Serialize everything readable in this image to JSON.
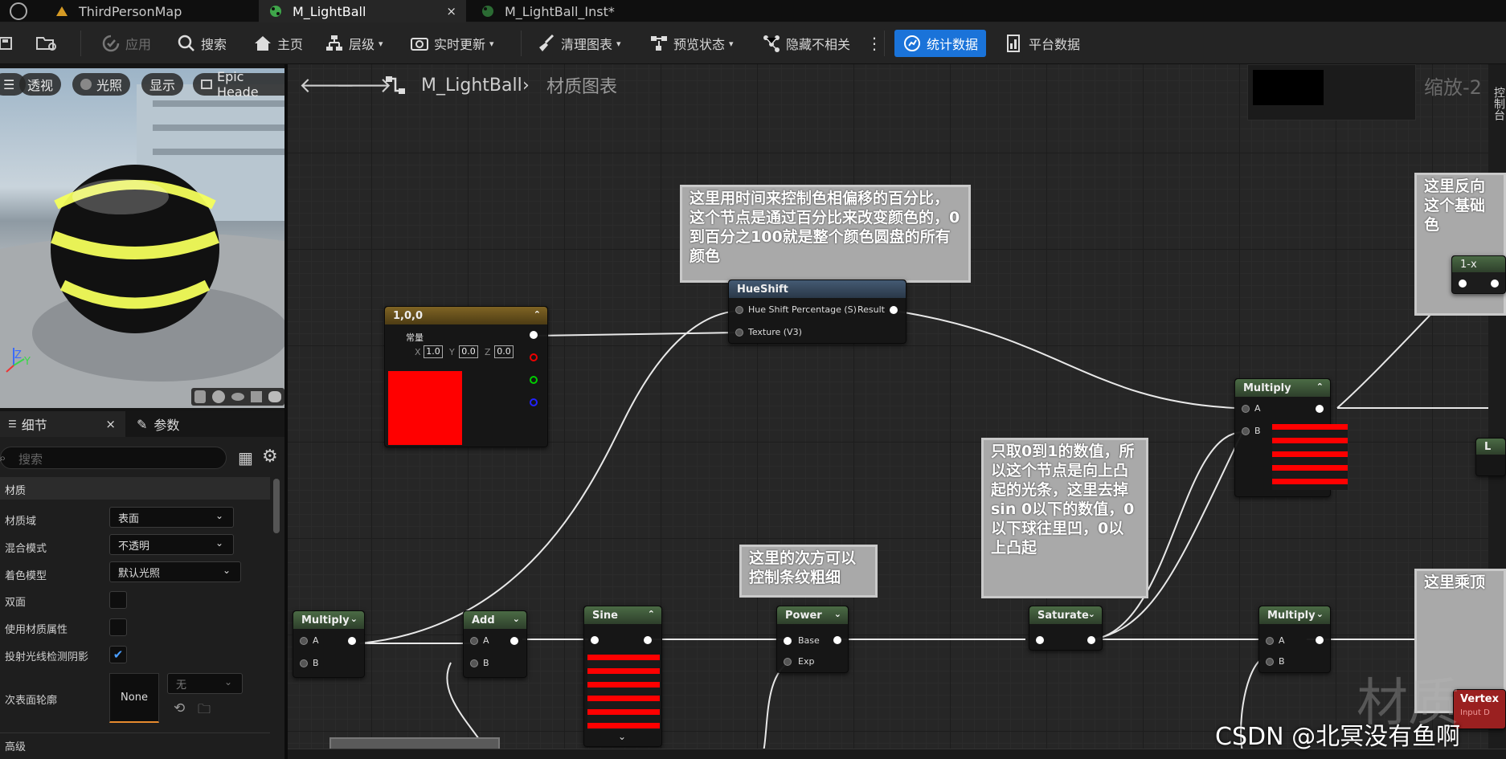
{
  "tabs": [
    {
      "label": "ThirdPersonMap"
    },
    {
      "label": "M_LightBall",
      "close": "×"
    },
    {
      "label": "M_LightBall_Inst*"
    }
  ],
  "toolbar": {
    "apply": "应用",
    "search": "搜索",
    "home": "主页",
    "hierarchy": "层级",
    "live_update": "实时更新",
    "clean_graph": "清理图表",
    "preview_state": "预览状态",
    "hide_unrelated": "隐藏不相关",
    "stats": "统计数据",
    "platform_stats": "平台数据"
  },
  "viewport": {
    "perspective": "透视",
    "lighting": "光照",
    "show": "显示",
    "epic": "Epic Heade",
    "axis_z": "Z",
    "axis_y": "Y"
  },
  "details": {
    "tab_details": "细节",
    "tab_close": "×",
    "tab_params": "参数",
    "search_placeholder": "搜索",
    "section_material": "材质",
    "rows": [
      {
        "label": "材质域",
        "value": "表面"
      },
      {
        "label": "混合模式",
        "value": "不透明"
      },
      {
        "label": "着色模型",
        "value": "默认光照"
      },
      {
        "label": "双面"
      },
      {
        "label": "使用材质属性"
      },
      {
        "label": "投射光线检测阴影"
      },
      {
        "label": "次表面轮廓"
      }
    ],
    "none_button": "None",
    "none_dropdown": "无",
    "section_advanced": "高级"
  },
  "graph": {
    "breadcrumb_root": "M_LightBall",
    "breadcrumb_sep": "›",
    "breadcrumb_child": "材质图表",
    "zoom": "缩放-2",
    "side_label": "控制台",
    "watermark": "材质",
    "const": {
      "title": "1,0,0",
      "label": "常量",
      "x_label": "X",
      "x": "1.0",
      "y_label": "Y",
      "y": "0.0",
      "z_label": "Z",
      "z": "0.0"
    },
    "hueshift": {
      "title": "HueShift",
      "pin1": "Hue Shift Percentage (S)",
      "pin2": "Texture (V3)",
      "out": "Result"
    },
    "multiply_big": {
      "title": "Multiply",
      "a": "A",
      "b": "B"
    },
    "one_minus": {
      "title": "1-x"
    },
    "multiply_left": {
      "title": "Multiply",
      "a": "A",
      "b": "B"
    },
    "add": {
      "title": "Add",
      "a": "A",
      "b": "B"
    },
    "sine": {
      "title": "Sine"
    },
    "power": {
      "title": "Power",
      "base": "Base",
      "exp": "Exp"
    },
    "saturate": {
      "title": "Saturate"
    },
    "multiply_right": {
      "title": "Multiply",
      "a": "A",
      "b": "B"
    },
    "vertex": {
      "title": "Vertex",
      "sub": "Input D"
    },
    "lerp": {
      "title": "L"
    },
    "comments": {
      "hue": "这里用时间来控制色相偏移的百分比，这个节点是通过百分比来改变颜色的，0到百分之100就是整个颜色圆盘的所有颜色",
      "saturate": "只取0到1的数值，所以这个节点是向上凸起的光条，这里去掉sin 0以下的数值，0以下球往里凹，0以上凸起",
      "power": "这里的次方可以控制条纹粗细",
      "reverse": "这里反向这个基础色",
      "multiply": "这里乘顶"
    }
  },
  "watermark_csdn": "CSDN @北冥没有鱼啊",
  "colors": {
    "accent": "#1a73d9",
    "const_color": "#ff0000"
  }
}
